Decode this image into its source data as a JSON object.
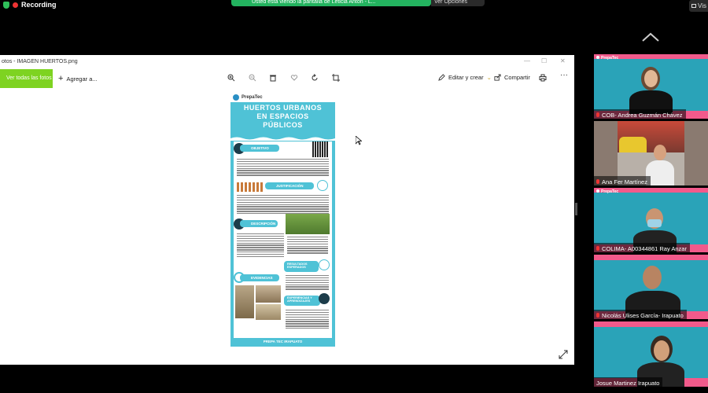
{
  "topbar": {
    "recording_label": "Recording",
    "share_banner_text": "Usted está viendo la pantalla de Leticia Antón - L...",
    "view_options_label": "Ver Opciones",
    "view_right_label": "Vis"
  },
  "viewer": {
    "window_title": "otos - IMAGEN HUERTOS.png",
    "toolbar": {
      "see_all_label": "Ver todas las fotos",
      "add_label": "Agregar a...",
      "edit_create_label": "Editar y crear",
      "share_label": "Compartir"
    }
  },
  "poster": {
    "brand": "PrepaTec",
    "title_line1": "HUERTOS URBANOS",
    "title_line2": "EN ESPACIOS",
    "title_line3": "PÚBLICOS",
    "sections": {
      "objetivo": "OBJETIVO",
      "justificacion": "JUSTIFICACIÓN",
      "descripcion": "DESCRIPCIÓN",
      "resultados": "RESULTADOS ESPERADOS",
      "evidencias": "EVIDENCIAS",
      "experiencias": "EXPERIENCIAS Y APRENDIZAJES"
    },
    "footer": "PREPA TEC IRAPUATO"
  },
  "participants": [
    {
      "name": "COB- Andrea Guzmán Chávez",
      "brand": "PrepaTec"
    },
    {
      "name": "Ana Fer Martínez",
      "brand": ""
    },
    {
      "name": "COLIMA- A00344861 Ray Anzar",
      "brand": "PrepaTec"
    },
    {
      "name": "Nicolás Ulises García- Irapuato",
      "brand": ""
    },
    {
      "name": "Josue Martinez Irapuato",
      "brand": ""
    }
  ],
  "colors": {
    "accent_green": "#7ed321",
    "zoom_green": "#23b35f",
    "poster_teal": "#4fc2d6",
    "tile_pink": "#f25a8b",
    "active_speaker": "#d6e23a"
  }
}
